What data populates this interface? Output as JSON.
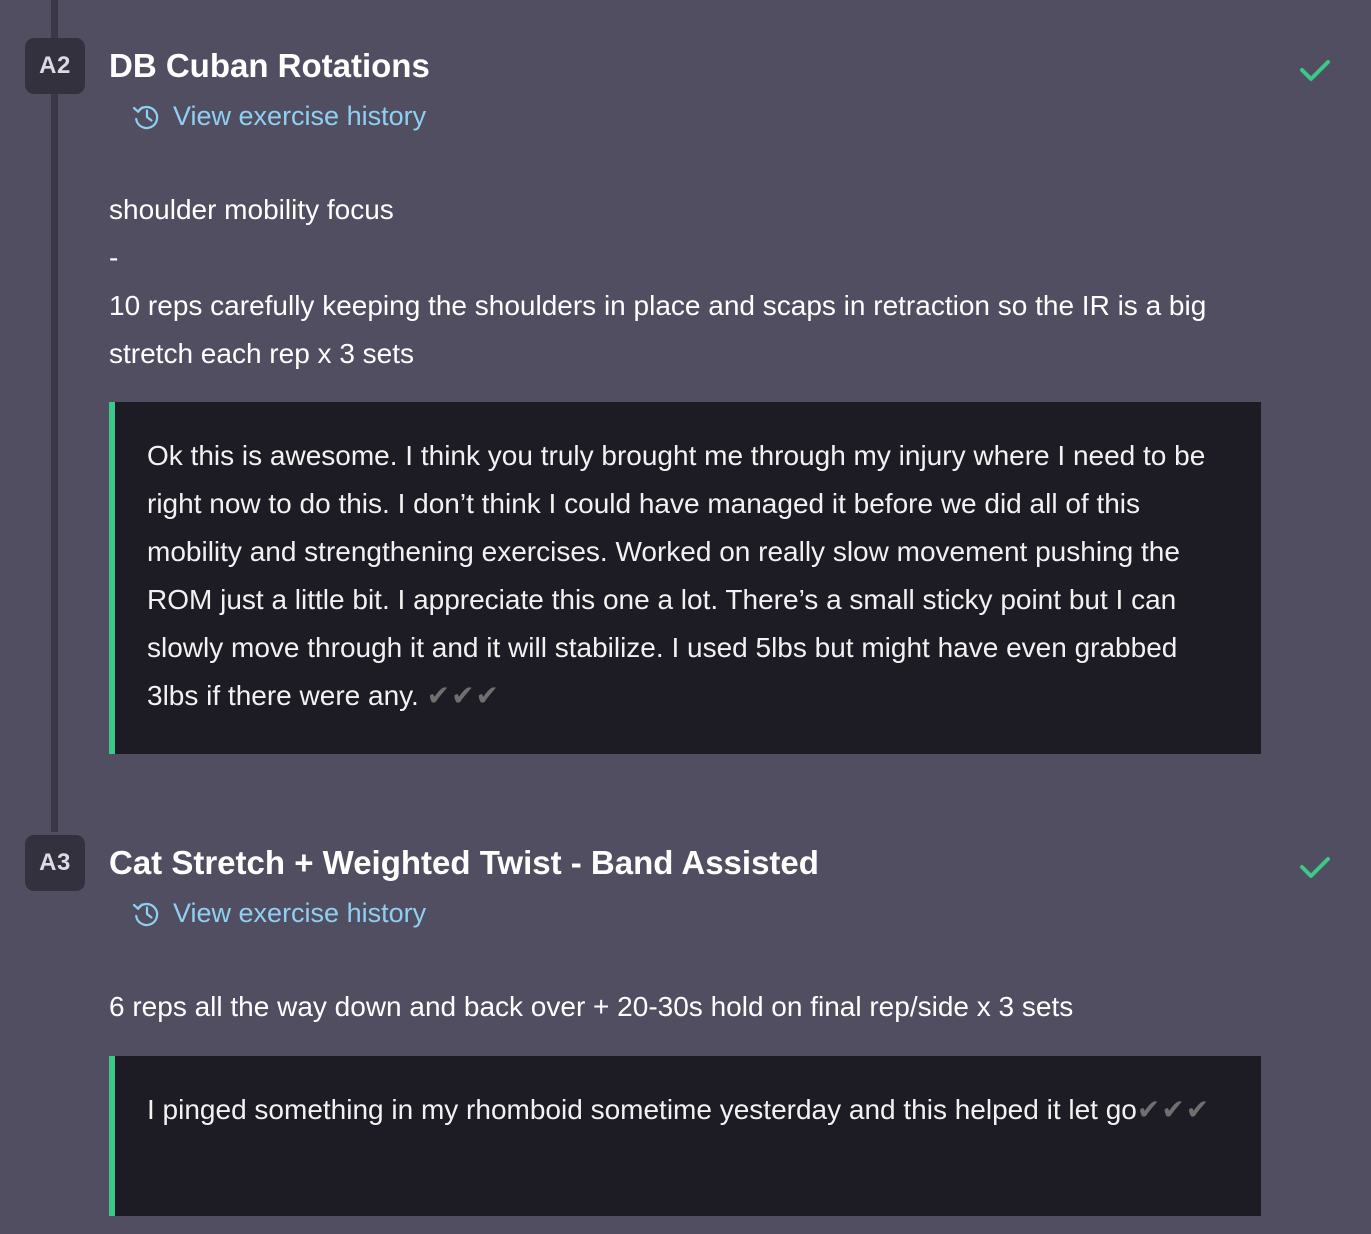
{
  "exercises": [
    {
      "badge": "A2",
      "title": "DB Cuban Rotations",
      "history_link": "View exercise history",
      "description_lines": [
        "shoulder mobility focus",
        "-",
        "10 reps carefully keeping the shoulders in place and scaps in retraction so the IR is a big stretch each rep x 3 sets"
      ],
      "note": "Ok this is awesome. I think you truly brought me through my injury where I need to be right now to do this. I don’t think I could have managed it before we did all of this mobility and strengthening exercises. Worked on really slow movement pushing the ROM just a little bit. I appreciate this one a lot. There’s a small sticky point but I can slowly move through it and it will stabilize. I used 5lbs but might have even grabbed 3lbs if there were any. ",
      "note_checks": "✔︎✔︎✔︎",
      "completed": true
    },
    {
      "badge": "A3",
      "title": "Cat Stretch + Weighted Twist - Band Assisted",
      "history_link": "View exercise history",
      "description_lines": [
        "6 reps all the way down and back over + 20-30s hold on final rep/side x 3 sets"
      ],
      "note": "I pinged something in my rhomboid sometime yesterday and this helped it let go",
      "note_checks": "✔︎✔︎✔︎",
      "completed": true
    }
  ],
  "icons": {
    "history": "history-clock-icon",
    "completed": "checkmark-icon"
  },
  "colors": {
    "background": "#524e62",
    "badge": "#34313f",
    "link": "#8fd0f2",
    "check": "#3cc887",
    "note_background": "#1d1c24",
    "note_border": "#3cc887"
  }
}
